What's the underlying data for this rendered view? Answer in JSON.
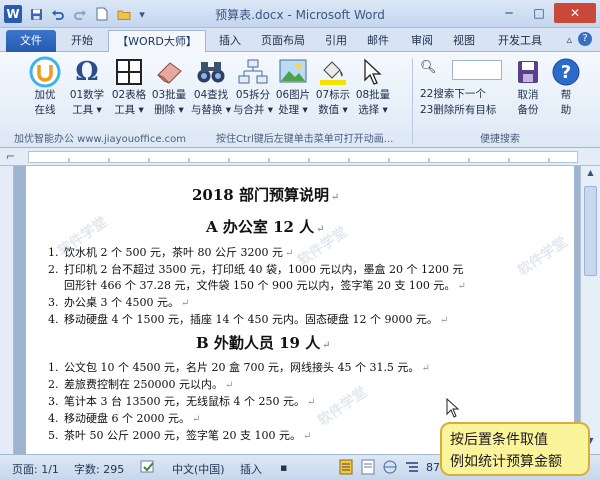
{
  "app": {
    "title": "预算表.docx - Microsoft Word",
    "icon_letter": "W"
  },
  "qat": {
    "icons": [
      "save-icon",
      "undo-icon",
      "redo-icon",
      "new-document-icon",
      "open-folder-icon"
    ]
  },
  "tabs": [
    {
      "label": "文件",
      "kind": "file"
    },
    {
      "label": "开始"
    },
    {
      "label": "【WORD大师】",
      "active": true
    },
    {
      "label": "插入"
    },
    {
      "label": "页面布局"
    },
    {
      "label": "引用"
    },
    {
      "label": "邮件"
    },
    {
      "label": "审阅"
    },
    {
      "label": "视图"
    },
    {
      "label": "开发工具"
    }
  ],
  "ribbon": {
    "buttons": [
      {
        "id": "jiayou",
        "line1": "加优",
        "line2": "在线"
      },
      {
        "id": "shuxue",
        "line1": "01数学",
        "line2": "工具 ▾"
      },
      {
        "id": "biaoge",
        "line1": "02表格",
        "line2": "工具 ▾"
      },
      {
        "id": "piliang",
        "line1": "03批量",
        "line2": "删除 ▾"
      },
      {
        "id": "chazhao",
        "line1": "04查找",
        "line2": "与替换 ▾"
      },
      {
        "id": "chaifen",
        "line1": "05拆分",
        "line2": "与合并 ▾"
      },
      {
        "id": "tupian",
        "line1": "06图片",
        "line2": "处理 ▾"
      },
      {
        "id": "biaoshi",
        "line1": "07标示",
        "line2": "数值 ▾"
      },
      {
        "id": "xuanze",
        "line1": "08批量",
        "line2": "选择 ▾"
      }
    ],
    "search": {
      "next_label": "22搜索下一个",
      "clear_label": "23删除所有目标",
      "cancel_line1": "取消",
      "cancel_line2": "备份",
      "help_line1": "帮",
      "help_line2": "助"
    },
    "group_left": "加优智能办公 www.jiayouoffice.com",
    "group_mid": "按住Ctrl键后左键单击菜单可打开动画...",
    "group_right": "便捷搜索"
  },
  "document": {
    "title": "2018 部门预算说明",
    "section_a": "A 办公室 12 人",
    "list_a": [
      {
        "num": "1.",
        "text": "饮水机 2 个 500 元，茶叶 80 公斤 3200 元"
      },
      {
        "num": "2.",
        "text": "打印机 2 台不超过 3500 元，打印纸 40 袋，1000 元以内，墨盒 20 个 1200 元"
      },
      {
        "num": "",
        "text": "回形针 466 个 37.28 元，文件袋 150 个 900 元以内，签字笔 20 支 100 元。"
      },
      {
        "num": "3.",
        "text": "办公桌 3 个 4500 元。"
      },
      {
        "num": "4.",
        "text": "移动硬盘 4 个 1500 元，插座 14 个 450 元内。固态硬盘 12 个 9000 元。"
      }
    ],
    "section_b": "B 外勤人员 19 人",
    "list_b": [
      {
        "num": "1.",
        "text": "公文包 10 个 4500 元，名片 20 盒 700 元，网线接头 45 个 31.5 元。"
      },
      {
        "num": "2.",
        "text": "差旅费控制在 250000 元以内。"
      },
      {
        "num": "3.",
        "text": "笔计本 3 台 13500 元，无线鼠标 4 个 250 元。"
      },
      {
        "num": "4.",
        "text": "移动硬盘 6 个 2000 元。"
      },
      {
        "num": "5.",
        "text": "茶叶 50 公斤 2000 元，签字笔 20 支 100 元。"
      }
    ]
  },
  "status": {
    "page": "页面: 1/1",
    "words": "字数: 295",
    "lang": "中文(中国)",
    "mode": "插入",
    "zoom": "87"
  },
  "callout": {
    "line1": "按后置条件取值",
    "line2": "例如统计预算金额"
  },
  "watermark": {
    "text": "软件学堂"
  },
  "colors": {
    "accent": "#2a5cae",
    "callout_bg": "#fcf49a",
    "callout_border": "#d9ae38"
  }
}
